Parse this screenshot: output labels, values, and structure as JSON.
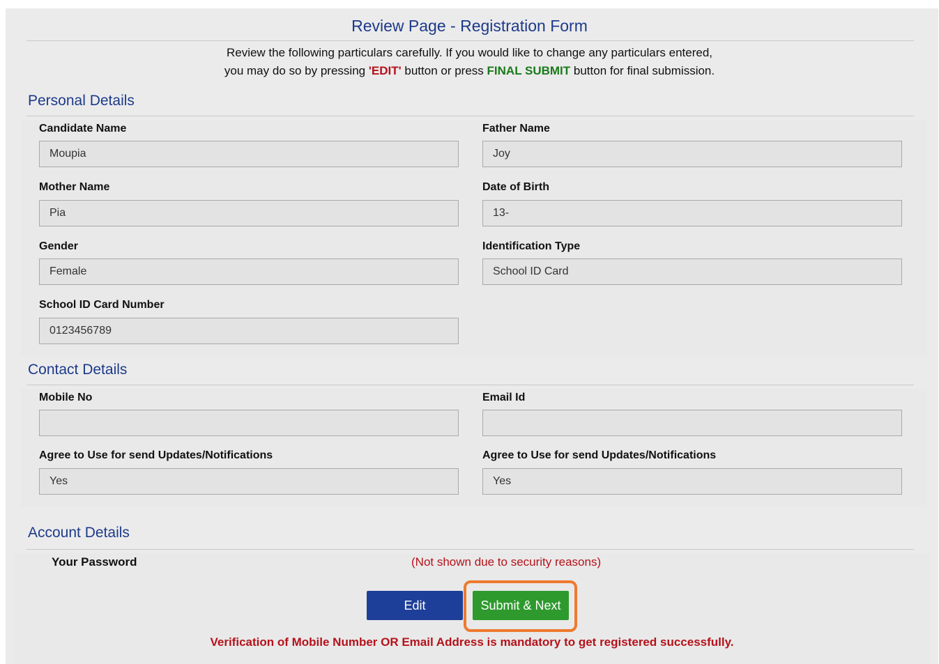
{
  "header": {
    "title": "Review Page - Registration Form",
    "instruction_line1": "Review the following particulars carefully. If you would like to change any particulars entered,",
    "instruction_line2_prefix": "you may do so by pressing",
    "instruction_edit_keyword": "'EDIT'",
    "instruction_line2_middle": "button or press",
    "instruction_final_keyword": "FINAL SUBMIT",
    "instruction_line2_suffix": "button for final submission."
  },
  "personal": {
    "section_title": "Personal Details",
    "candidate_name": {
      "label": "Candidate Name",
      "value": "Moupia"
    },
    "father_name": {
      "label": "Father Name",
      "value": "Joy"
    },
    "mother_name": {
      "label": "Mother Name",
      "value": "Pia"
    },
    "date_of_birth": {
      "label": "Date of Birth",
      "value": "13-"
    },
    "gender": {
      "label": "Gender",
      "value": "Female"
    },
    "identification_type": {
      "label": "Identification Type",
      "value": "School ID Card"
    },
    "school_id_number": {
      "label": "School ID Card Number",
      "value": "0123456789"
    }
  },
  "contact": {
    "section_title": "Contact Details",
    "mobile_no": {
      "label": "Mobile No",
      "value": ""
    },
    "email_id": {
      "label": "Email Id",
      "value": ""
    },
    "agree_mobile": {
      "label": "Agree to Use for send Updates/Notifications",
      "value": "Yes"
    },
    "agree_email": {
      "label": "Agree to Use for send Updates/Notifications",
      "value": "Yes"
    }
  },
  "account": {
    "section_title": "Account Details",
    "password_label": "Your Password",
    "password_note": "(Not shown due to security reasons)"
  },
  "actions": {
    "edit_label": "Edit",
    "submit_label": "Submit & Next"
  },
  "footer": {
    "warning": "Verification of Mobile Number OR Email Address is mandatory to get registered successfully."
  },
  "colors": {
    "title_blue": "#1d3a8a",
    "warning_red": "#b5121b",
    "final_green": "#1a7a1a",
    "edit_button": "#1e3f99",
    "submit_button": "#2e9a2e",
    "highlight_orange": "#ee7a2f"
  }
}
